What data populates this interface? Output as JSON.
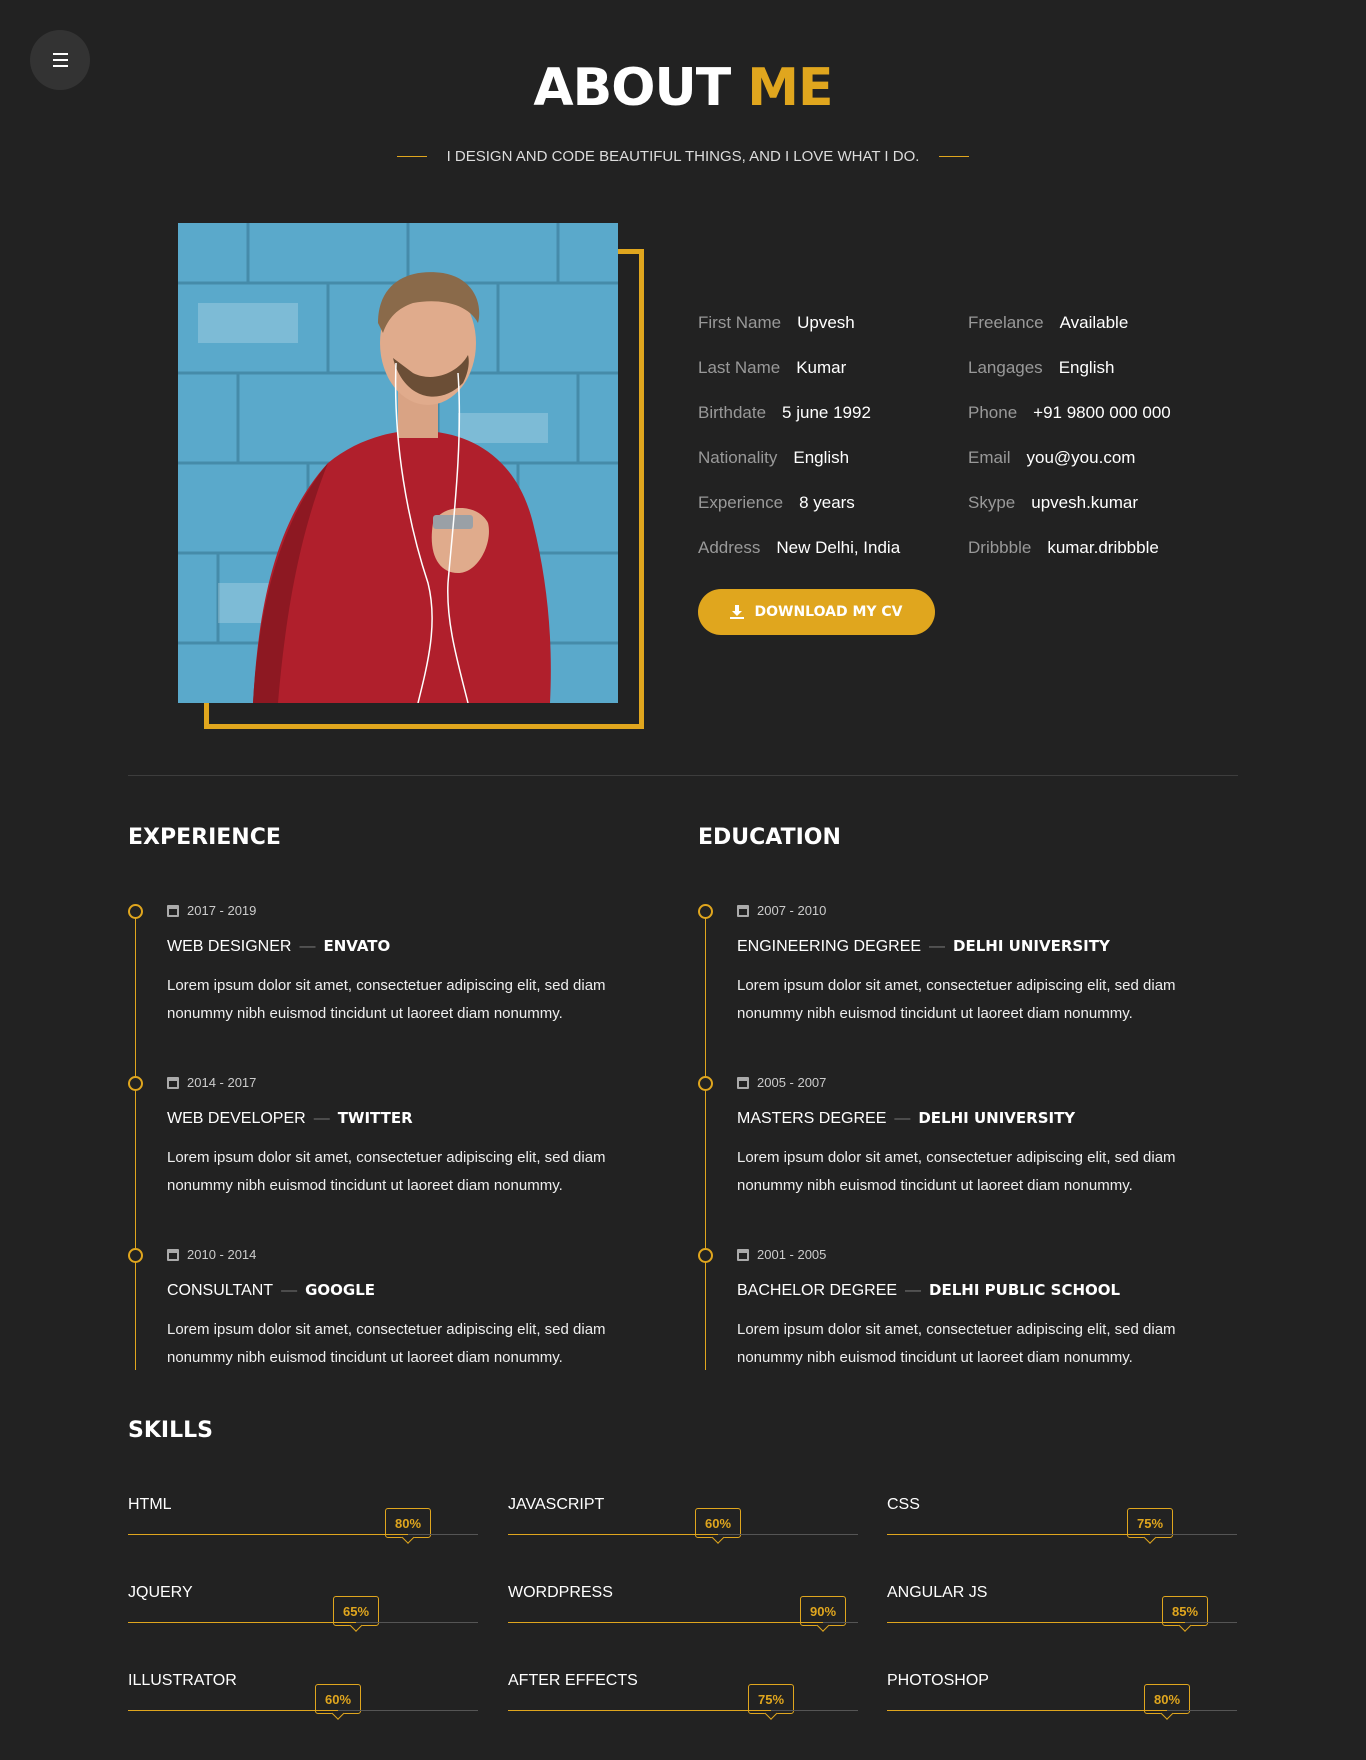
{
  "title": {
    "part1": "ABOUT",
    "part2": "ME"
  },
  "subtitle": "I DESIGN AND CODE BEAUTIFUL THINGS, AND I LOVE WHAT I DO.",
  "colors": {
    "accent": "#e0a61e",
    "background": "#222222"
  },
  "info": [
    {
      "label": "First Name",
      "value": "Upvesh"
    },
    {
      "label": "Freelance",
      "value": "Available"
    },
    {
      "label": "Last Name",
      "value": "Kumar"
    },
    {
      "label": "Langages",
      "value": "English"
    },
    {
      "label": "Birthdate",
      "value": "5 june 1992"
    },
    {
      "label": "Phone",
      "value": "+91 9800 000 000"
    },
    {
      "label": "Nationality",
      "value": "English"
    },
    {
      "label": "Email",
      "value": "you@you.com"
    },
    {
      "label": "Experience",
      "value": "8 years"
    },
    {
      "label": "Skype",
      "value": "upvesh.kumar"
    },
    {
      "label": "Address",
      "value": "New Delhi, India"
    },
    {
      "label": "Dribbble",
      "value": "kumar.dribbble"
    }
  ],
  "cv_button": "DOWNLOAD MY CV",
  "experience": {
    "title": "EXPERIENCE",
    "items": [
      {
        "date": "2017 - 2019",
        "role": "WEB DESIGNER",
        "org": "ENVATO",
        "desc": "Lorem ipsum dolor sit amet, consectetuer adipiscing elit, sed diam nonummy nibh euismod tincidunt ut laoreet diam nonummy."
      },
      {
        "date": "2014 - 2017",
        "role": "WEB DEVELOPER",
        "org": "TWITTER",
        "desc": "Lorem ipsum dolor sit amet, consectetuer adipiscing elit, sed diam nonummy nibh euismod tincidunt ut laoreet diam nonummy."
      },
      {
        "date": "2010 - 2014",
        "role": "CONSULTANT",
        "org": "GOOGLE",
        "desc": "Lorem ipsum dolor sit amet, consectetuer adipiscing elit, sed diam nonummy nibh euismod tincidunt ut laoreet diam nonummy."
      }
    ]
  },
  "education": {
    "title": "EDUCATION",
    "items": [
      {
        "date": "2007 - 2010",
        "role": "ENGINEERING DEGREE",
        "org": "DELHI UNIVERSITY",
        "desc": "Lorem ipsum dolor sit amet, consectetuer adipiscing elit, sed diam nonummy nibh euismod tincidunt ut laoreet diam nonummy."
      },
      {
        "date": "2005 - 2007",
        "role": "MASTERS DEGREE",
        "org": "DELHI UNIVERSITY",
        "desc": "Lorem ipsum dolor sit amet, consectetuer adipiscing elit, sed diam nonummy nibh euismod tincidunt ut laoreet diam nonummy."
      },
      {
        "date": "2001 - 2005",
        "role": "BACHELOR DEGREE",
        "org": "DELHI PUBLIC SCHOOL",
        "desc": "Lorem ipsum dolor sit amet, consectetuer adipiscing elit, sed diam nonummy nibh euismod tincidunt ut laoreet diam nonummy."
      }
    ]
  },
  "skills": {
    "title": "SKILLS",
    "items": [
      {
        "name": "HTML",
        "percent": 80,
        "label": "80%"
      },
      {
        "name": "JAVASCRIPT",
        "percent": 60,
        "label": "60%"
      },
      {
        "name": "CSS",
        "percent": 75,
        "label": "75%"
      },
      {
        "name": "JQUERY",
        "percent": 65,
        "label": "65%"
      },
      {
        "name": "WORDPRESS",
        "percent": 90,
        "label": "90%"
      },
      {
        "name": "ANGULAR JS",
        "percent": 85,
        "label": "85%"
      },
      {
        "name": "ILLUSTRATOR",
        "percent": 60,
        "label": "60%"
      },
      {
        "name": "AFTER EFFECTS",
        "percent": 75,
        "label": "75%"
      },
      {
        "name": "PHOTOSHOP",
        "percent": 80,
        "label": "80%"
      }
    ]
  }
}
